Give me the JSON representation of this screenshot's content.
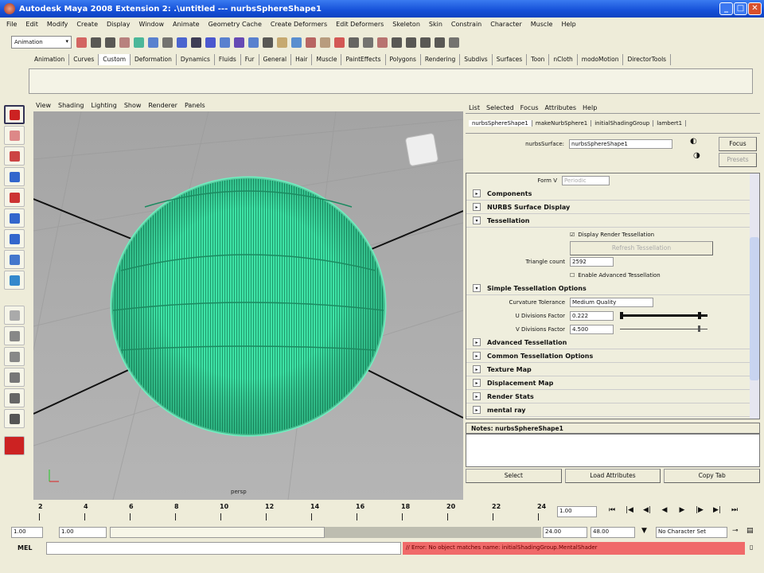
{
  "window": {
    "title": "Autodesk Maya 2008 Extension 2: .\\untitled   ---   nurbsSphereShape1",
    "min": "_",
    "max": "□",
    "close": "✕"
  },
  "menubar": [
    "File",
    "Edit",
    "Modify",
    "Create",
    "Display",
    "Window",
    "Animate",
    "Geometry Cache",
    "Create Deformers",
    "Edit Deformers",
    "Skeleton",
    "Skin",
    "Constrain",
    "Character",
    "Muscle",
    "Help"
  ],
  "statusline": {
    "menuset": "Animation"
  },
  "shelf": {
    "tabs": [
      "Animation",
      "Curves",
      "Custom",
      "Deformation",
      "Dynamics",
      "Fluids",
      "Fur",
      "General",
      "Hair",
      "Muscle",
      "PaintEffects",
      "Polygons",
      "Rendering",
      "Subdivs",
      "Surfaces",
      "Toon",
      "nCloth",
      "modoMotion",
      "DirectorTools"
    ],
    "active": "Custom"
  },
  "viewport": {
    "menu": [
      "View",
      "Shading",
      "Lighting",
      "Show",
      "Renderer",
      "Panels"
    ],
    "camera": "persp",
    "colors": {
      "sphere": "#3ee3a6",
      "bg": "#aaaaaa"
    }
  },
  "attr_editor": {
    "menu": [
      "List",
      "Selected",
      "Focus",
      "Attributes",
      "Help"
    ],
    "tabs": [
      "nurbsSphereShape1",
      "makeNurbSphere1",
      "initialShadingGroup",
      "lambert1"
    ],
    "node_label": "nurbsSurface:",
    "node_value": "nurbsSphereShape1",
    "focus": "Focus",
    "presets": "Presets",
    "formv_label": "Form V",
    "formv_value": "Periodic",
    "frames_top": [
      "Components",
      "NURBS Surface Display"
    ],
    "tessellation": {
      "title": "Tessellation",
      "display_render": "Display Render Tessellation",
      "refresh": "Refresh Tessellation",
      "triangle_label": "Triangle count",
      "triangle_value": "2592",
      "enable_adv": "Enable Advanced Tessellation"
    },
    "simple": {
      "title": "Simple Tessellation Options",
      "curv_label": "Curvature Tolerance",
      "curv_value": "Medium Quality",
      "u_label": "U Divisions Factor",
      "u_value": "0.222",
      "v_label": "V Divisions Factor",
      "v_value": "4.500"
    },
    "frames_bottom": [
      "Advanced Tessellation",
      "Common Tessellation Options",
      "Texture Map",
      "Displacement Map",
      "Render Stats",
      "mental ray"
    ],
    "notes": "Notes:  nurbsSphereShape1",
    "buttons": [
      "Select",
      "Load Attributes",
      "Copy Tab"
    ]
  },
  "timeline": {
    "ticks": [
      "2",
      "4",
      "6",
      "8",
      "10",
      "12",
      "14",
      "16",
      "18",
      "20",
      "22",
      "24"
    ],
    "current": "1.00",
    "playback": [
      "⏮",
      "|◀",
      "◀|",
      "◀",
      "▶",
      "|▶",
      "▶|",
      "⏭"
    ]
  },
  "range": {
    "start": "1.00",
    "pstart": "1.00",
    "pend": "24.00",
    "end": "48.00",
    "charset": "No Character Set"
  },
  "cmd": {
    "label": "MEL",
    "error": "// Error: No object matches name: initialShadingGroup.MentalShader",
    "error_color": "#f06a6a"
  }
}
